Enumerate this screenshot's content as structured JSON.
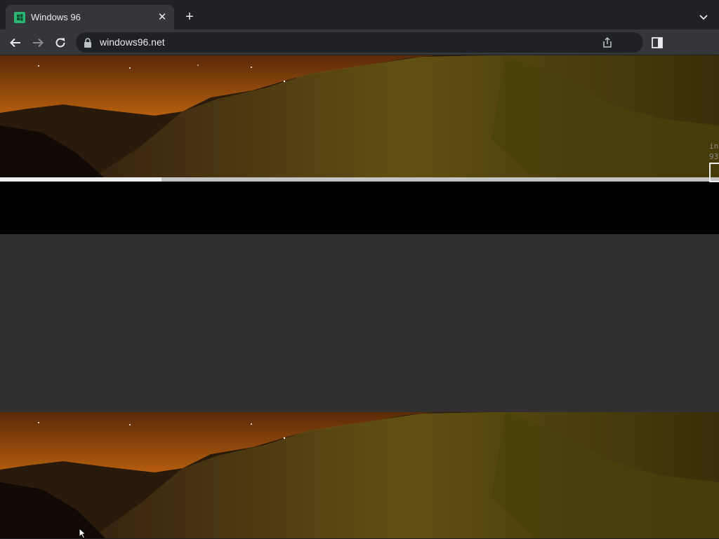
{
  "browser": {
    "tab": {
      "title": "Windows 96",
      "favicon": "windows96-logo-icon",
      "close_label": "✕"
    },
    "new_tab_label": "+",
    "address_bar": {
      "url": "windows96.net"
    }
  },
  "page": {
    "side_text_line1": "in",
    "side_text_line2": "93"
  },
  "colors": {
    "tab_strip": "#202124",
    "toolbar": "#35363a",
    "omnibox": "#202124",
    "content_gray": "#303030",
    "favicon_green": "#2bb673"
  }
}
